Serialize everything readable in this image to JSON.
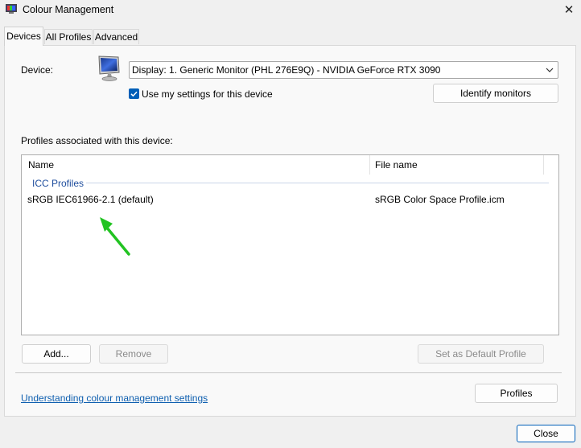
{
  "window": {
    "title": "Colour Management",
    "close_glyph": "✕"
  },
  "tabs": [
    {
      "label": "Devices",
      "active": true
    },
    {
      "label": "All Profiles",
      "active": false
    },
    {
      "label": "Advanced",
      "active": false
    }
  ],
  "device": {
    "label": "Device:",
    "selected": "Display: 1. Generic Monitor (PHL 276E9Q) - NVIDIA GeForce RTX 3090",
    "use_settings_label": "Use my settings for this device",
    "use_settings_checked": true,
    "identify_button": "Identify monitors"
  },
  "profiles": {
    "section_label": "Profiles associated with this device:",
    "columns": [
      "Name",
      "File name"
    ],
    "group": "ICC Profiles",
    "rows": [
      {
        "name": "sRGB IEC61966-2.1 (default)",
        "file": "sRGB Color Space Profile.icm"
      }
    ]
  },
  "buttons": {
    "add": "Add...",
    "remove": "Remove",
    "set_default": "Set as Default Profile",
    "profiles": "Profiles",
    "close": "Close"
  },
  "link": "Understanding colour management settings",
  "colors": {
    "accent": "#005fb8",
    "link": "#0d5eaf",
    "annotation_arrow": "#22c322"
  },
  "icons": [
    "colour-management-app-icon",
    "monitor-icon",
    "chevron-down-icon",
    "checkmark-icon",
    "close-icon",
    "annotation-arrow-icon"
  ]
}
